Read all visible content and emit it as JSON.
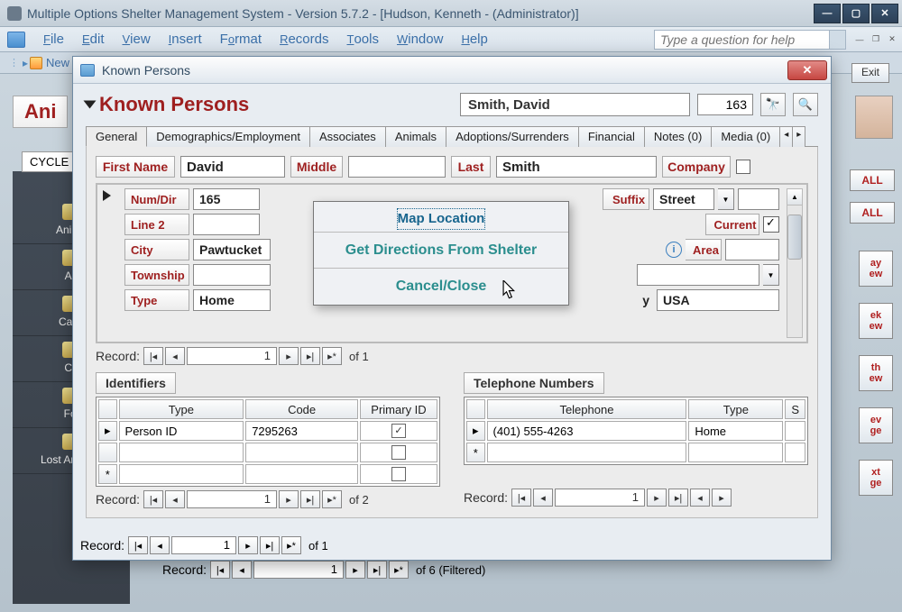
{
  "titlebar": {
    "text": "Multiple Options Shelter Management System - Version 5.7.2 - [Hudson, Kenneth - (Administrator)]"
  },
  "menus": [
    "File",
    "Edit",
    "View",
    "Insert",
    "Format",
    "Records",
    "Tools",
    "Window",
    "Help"
  ],
  "help_placeholder": "Type a question for help",
  "toolbar": {
    "new_label": "New"
  },
  "exit_label": "Exit",
  "side": {
    "title": "Ani",
    "cycle": "CYCLE",
    "items": [
      "Anima",
      "Ad",
      "Cash",
      "Co",
      "Fol",
      "Lost Animals"
    ]
  },
  "right": {
    "all1": "ALL",
    "all2": "ALL",
    "btns": [
      "ay\new",
      "ek\new",
      "th\new",
      "ev\nge",
      "xt\nge"
    ]
  },
  "kp": {
    "window_title": "Known Persons",
    "heading": "Known Persons",
    "display_name": "Smith, David",
    "person_id": "163",
    "tabs": [
      "General",
      "Demographics/Employment",
      "Associates",
      "Animals",
      "Adoptions/Surrenders",
      "Financial",
      "Notes (0)",
      "Media (0)"
    ],
    "name_row": {
      "first_label": "First Name",
      "first": "David",
      "middle_label": "Middle",
      "middle": "",
      "last_label": "Last",
      "last": "Smith",
      "company_label": "Company"
    },
    "addr": {
      "numdir_label": "Num/Dir",
      "num": "165",
      "line2_label": "Line 2",
      "line2": "",
      "city_label": "City",
      "city": "Pawtucket",
      "township_label": "Township",
      "township": "",
      "type_label": "Type",
      "type": "Home",
      "suffix_label": "Suffix",
      "suffix": "Street",
      "current_label": "Current",
      "area_label": "Area",
      "country_y": "y",
      "country": "USA"
    },
    "addr_recnav": {
      "counter": "1",
      "of": "of  1"
    },
    "identifiers": {
      "title": "Identifiers",
      "cols": [
        "Type",
        "Code",
        "Primary ID"
      ],
      "row": {
        "type": "Person ID",
        "code": "7295263",
        "primary": true
      },
      "recnav": {
        "counter": "1",
        "of": "of  2"
      }
    },
    "telephones": {
      "title": "Telephone Numbers",
      "cols": [
        "Telephone",
        "Type",
        "S"
      ],
      "row": {
        "tel": "(401) 555-4263",
        "type": "Home"
      },
      "recnav": {
        "counter": "1"
      }
    },
    "bottom_recnav": {
      "counter": "1",
      "of": "of  1"
    }
  },
  "popup": {
    "map": "Map Location",
    "dir": "Get Directions From Shelter",
    "cancel": "Cancel/Close"
  },
  "bg_recnav": {
    "counter": "1",
    "of": "of 6 (Filtered)"
  },
  "record_label": "Record:"
}
